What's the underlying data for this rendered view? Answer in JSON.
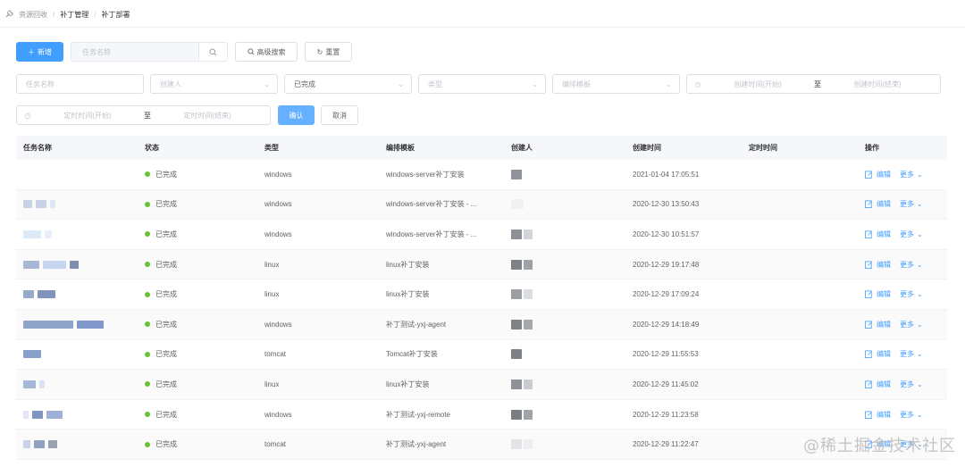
{
  "breadcrumb": {
    "items": [
      "资源回收",
      "补丁管理",
      "补丁部署"
    ],
    "sep": "/"
  },
  "toolbar": {
    "add_label": "新增",
    "search_placeholder": "任务名称",
    "advanced_label": "高级搜索",
    "reset_label": "重置"
  },
  "filters": {
    "task_name_placeholder": "任务名称",
    "creator_placeholder": "创建人",
    "status_value": "已完成",
    "type_placeholder": "类型",
    "template_placeholder": "编排模板",
    "create_start_placeholder": "创建时间(开始)",
    "create_end_placeholder": "创建时间(结束)",
    "range_sep": "至",
    "schedule_start_placeholder": "定时时间(开始)",
    "schedule_end_placeholder": "定时时间(结束)",
    "confirm_label": "确认",
    "cancel_label": "取消"
  },
  "table": {
    "columns": [
      "任务名称",
      "状态",
      "类型",
      "编排模板",
      "创建人",
      "创建时间",
      "定时时间",
      "操作"
    ],
    "rows": [
      {
        "status": "已完成",
        "type": "windows",
        "template": "windows-server补丁安装",
        "created": "2021-01-04 17:05:51",
        "scheduled": "",
        "edit": "编辑",
        "more": "更多"
      },
      {
        "status": "已完成",
        "type": "windows",
        "template": "windows-server补丁安装 - ...",
        "created": "2020-12-30 13:50:43",
        "scheduled": "",
        "edit": "编辑",
        "more": "更多"
      },
      {
        "status": "已完成",
        "type": "windows",
        "template": "windows-server补丁安装 - ...",
        "created": "2020-12-30 10:51:57",
        "scheduled": "",
        "edit": "编辑",
        "more": "更多"
      },
      {
        "status": "已完成",
        "type": "linux",
        "template": "linux补丁安装",
        "created": "2020-12-29 19:17:48",
        "scheduled": "",
        "edit": "编辑",
        "more": "更多"
      },
      {
        "status": "已完成",
        "type": "linux",
        "template": "linux补丁安装",
        "created": "2020-12-29 17:09:24",
        "scheduled": "",
        "edit": "编辑",
        "more": "更多"
      },
      {
        "status": "已完成",
        "type": "windows",
        "template": "补丁测试-yxj-agent",
        "created": "2020-12-29 14:18:49",
        "scheduled": "",
        "edit": "编辑",
        "more": "更多"
      },
      {
        "status": "已完成",
        "type": "tomcat",
        "template": "Tomcat补丁安装",
        "created": "2020-12-29 11:55:53",
        "scheduled": "",
        "edit": "编辑",
        "more": "更多"
      },
      {
        "status": "已完成",
        "type": "linux",
        "template": "linux补丁安装",
        "created": "2020-12-29 11:45:02",
        "scheduled": "",
        "edit": "编辑",
        "more": "更多"
      },
      {
        "status": "已完成",
        "type": "windows",
        "template": "补丁测试-yxj-remote",
        "created": "2020-12-29 11:23:58",
        "scheduled": "",
        "edit": "编辑",
        "more": "更多"
      },
      {
        "status": "已完成",
        "type": "tomcat",
        "template": "补丁测试-yxj-agent",
        "created": "2020-12-29 11:22:47",
        "scheduled": "",
        "edit": "编辑",
        "more": "更多"
      }
    ]
  },
  "colors": {
    "primary": "#409eff",
    "success": "#67c23a",
    "header_bg": "#f5f7fa"
  },
  "watermark": "@稀土掘金技术社区"
}
